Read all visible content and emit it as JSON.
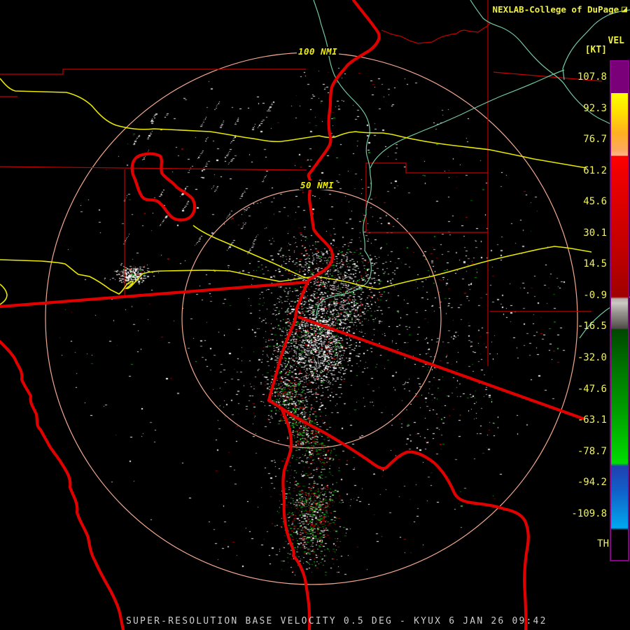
{
  "header": {
    "brand": "NEXLAB-College of DuPage",
    "brand_icon": "cod-logo-icon",
    "brand_icon_glyph": "◪"
  },
  "colorbar": {
    "title": "VEL",
    "units": "[KT]",
    "tick_labels": [
      "107.8",
      "92.3",
      "76.7",
      "61.2",
      "45.6",
      "30.1",
      "14.5",
      "-0.9",
      "-16.5",
      "-32.0",
      "-47.6",
      "-63.1",
      "-78.7",
      "-94.2",
      "-109.8"
    ],
    "bottom_label": "TH",
    "bands": [
      {
        "label": "107.8",
        "color": "#7a007a"
      },
      {
        "label": "92.3",
        "color": "#ffff00"
      },
      {
        "label": "76.7",
        "color": "#ffa830"
      },
      {
        "label": "61.2",
        "color": "#f00000"
      },
      {
        "label": "45.6",
        "color": "#d80000"
      },
      {
        "label": "30.1",
        "color": "#c00000"
      },
      {
        "label": "14.5",
        "color": "#b00000"
      },
      {
        "label": "-0.9",
        "color": "#a00000"
      },
      {
        "label": "-16.5",
        "color": "#8c8884"
      },
      {
        "label": "-32.0",
        "color": "#006000"
      },
      {
        "label": "-47.6",
        "color": "#008800"
      },
      {
        "label": "-63.1",
        "color": "#00b000"
      },
      {
        "label": "-78.7",
        "color": "#00dc00"
      },
      {
        "label": "-94.2",
        "color": "#1050c0"
      },
      {
        "label": "-109.8",
        "color": "#00a8f0"
      },
      {
        "label": "TH",
        "color": "#000000"
      }
    ]
  },
  "rings": {
    "outer_label": "100 NMI",
    "inner_label": "50 NMI"
  },
  "footer": {
    "caption": "SUPER-RESOLUTION BASE VELOCITY 0.5 DEG - KYUX 6 JAN 26 09:42"
  },
  "colors": {
    "background": "#000000",
    "range_ring": "#f2a890",
    "thick_boundary_red": "#e00000",
    "thin_county_red": "#c40000",
    "highway_yellow": "#e8e800",
    "river_green": "#72c8a0",
    "label_yellow": "#f0f040",
    "caption_gray": "#cccccc",
    "colorbar_border_purple": "#8a008a",
    "speckle_grays": [
      "#9a9a9a",
      "#b4b4b4",
      "#c8c8c8",
      "#dcdcdc",
      "#eeeeee",
      "#ffffff"
    ],
    "speckle_greens": [
      "#006400",
      "#008000",
      "#00a000",
      "#30b030"
    ],
    "speckle_reds": [
      "#600000",
      "#800000",
      "#980000",
      "#b00000"
    ]
  }
}
